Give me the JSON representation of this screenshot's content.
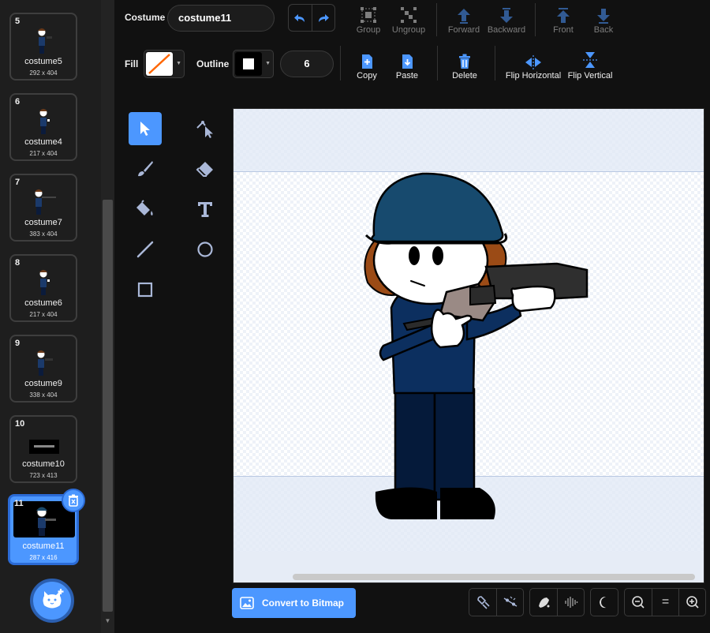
{
  "costumes": [
    {
      "number": "5",
      "name": "costume5",
      "size": "292 x 404"
    },
    {
      "number": "6",
      "name": "costume4",
      "size": "217 x 404"
    },
    {
      "number": "7",
      "name": "costume7",
      "size": "383 x 404"
    },
    {
      "number": "8",
      "name": "costume6",
      "size": "217 x 404"
    },
    {
      "number": "9",
      "name": "costume9",
      "size": "338 x 404"
    },
    {
      "number": "10",
      "name": "costume10",
      "size": "723 x 413"
    },
    {
      "number": "11",
      "name": "costume11",
      "size": "287 x 416",
      "selected": true
    }
  ],
  "toolbar": {
    "costume_label": "Costume",
    "costume_name": "costume11",
    "fill_label": "Fill",
    "outline_label": "Outline",
    "outline_width": "6",
    "group": "Group",
    "ungroup": "Ungroup",
    "forward": "Forward",
    "backward": "Backward",
    "front": "Front",
    "back": "Back",
    "copy": "Copy",
    "paste": "Paste",
    "delete": "Delete",
    "flip_horizontal": "Flip Horizontal",
    "flip_vertical": "Flip Vertical"
  },
  "colors": {
    "accent": "#4c97ff",
    "fill_swatch_line": "#ff6600",
    "outline_swatch": "#000000",
    "panel_bg": "#1e1e1e",
    "delete_icon": "#4c97ff"
  },
  "tools": [
    "select-icon",
    "reshape-icon",
    "brush-icon",
    "eraser-icon",
    "fill-icon",
    "text-icon",
    "line-icon",
    "circle-icon",
    "rectangle-icon"
  ],
  "bottom": {
    "convert_button": "Convert to Bitmap",
    "zoom_reset": "="
  }
}
